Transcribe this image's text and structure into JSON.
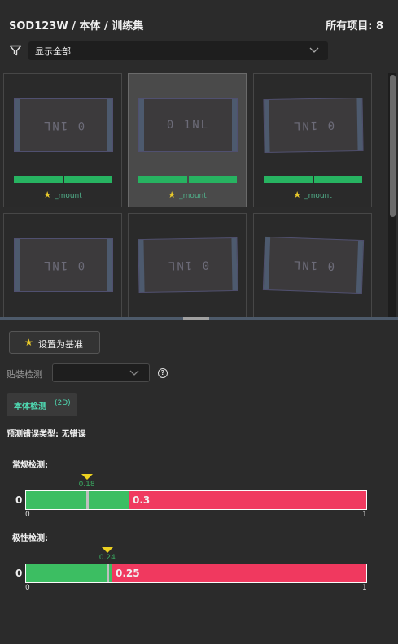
{
  "header": {
    "title": "SOD123W / 本体 / 训练集",
    "item_count": "所有项目: 8"
  },
  "filter": {
    "icon": "filter-icon",
    "selected": "显示全部"
  },
  "gallery": {
    "items": [
      {
        "marking": "0 1NL",
        "label": "_mount",
        "selected": false,
        "flipped": true
      },
      {
        "marking": "0 1NL",
        "label": "_mount",
        "selected": true,
        "flipped": false
      },
      {
        "marking": "0 1NL",
        "label": "_mount",
        "selected": false,
        "flipped": true
      },
      {
        "marking": "0 1NL",
        "selected": false,
        "flipped": true
      },
      {
        "marking": "0 1NL",
        "selected": false,
        "flipped": true
      },
      {
        "marking": "0 1NL",
        "selected": false,
        "flipped": true
      }
    ]
  },
  "actions": {
    "set_baseline_label": "设置为基准",
    "star_icon": "star-icon"
  },
  "mount": {
    "label": "贴装检测",
    "selected": ""
  },
  "tab": {
    "label": "本体检测",
    "sub": "(2D)"
  },
  "prediction": {
    "error_type": "预测错误类型: 无错误"
  },
  "normal": {
    "title": "常规检测:",
    "threshold": 0.18,
    "threshold_label": "0.18",
    "score": 0.3,
    "score_label": "0.3",
    "left_value": "0",
    "axis_min": "0",
    "axis_max": "1"
  },
  "polarity": {
    "title": "极性检测:",
    "threshold": 0.24,
    "threshold_label": "0.24",
    "score": 0.25,
    "score_label": "0.25",
    "left_value": "0",
    "axis_min": "0",
    "axis_max": "1"
  },
  "colors": {
    "pass": "#3cbe62",
    "fail": "#f0395f",
    "accent": "#4fd9b2",
    "marker": "#ecd120"
  }
}
